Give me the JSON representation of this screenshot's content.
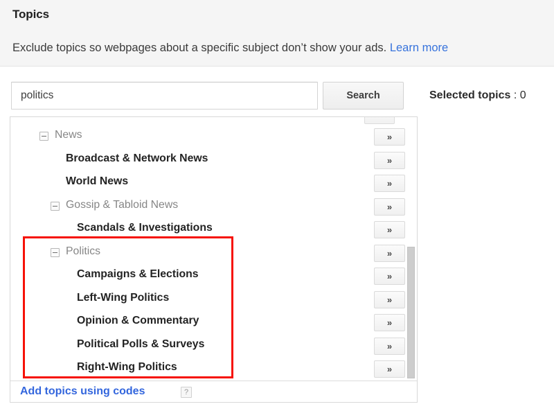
{
  "header": {
    "title": "Topics",
    "description": "Exclude topics so webpages about a specific subject don’t show your ads.",
    "learn_more_label": "Learn more",
    "link_color": "#3773dc",
    "band_background": "#f5f5f5"
  },
  "search": {
    "input_value": "politics",
    "input_placeholder": "",
    "button_label": "Search",
    "selected_topics_label": "Selected topics",
    "selected_topics_value": ": 0",
    "selected_topics_count": 0
  },
  "tree": {
    "clipped_top_row": {
      "label": "",
      "move_button_label": "»"
    },
    "move_button_label": "»",
    "toggle_icon": "minus-square-icon",
    "rows": [
      {
        "label": "News",
        "type": "parent",
        "level": 0,
        "expanded": true,
        "indent": 42,
        "label_indent": 64,
        "highlighted": false
      },
      {
        "label": "Broadcast & Network News",
        "type": "leaf",
        "level": 1,
        "expanded": false,
        "indent": 0,
        "label_indent": 80,
        "highlighted": false
      },
      {
        "label": "World News",
        "type": "leaf",
        "level": 1,
        "expanded": false,
        "indent": 0,
        "label_indent": 80,
        "highlighted": false
      },
      {
        "label": "Gossip & Tabloid News",
        "type": "parent",
        "level": 1,
        "expanded": true,
        "indent": 58,
        "label_indent": 80,
        "highlighted": false
      },
      {
        "label": "Scandals & Investigations",
        "type": "leaf",
        "level": 2,
        "expanded": false,
        "indent": 0,
        "label_indent": 96,
        "highlighted": false
      },
      {
        "label": "Politics",
        "type": "parent",
        "level": 1,
        "expanded": true,
        "indent": 58,
        "label_indent": 80,
        "highlighted": true
      },
      {
        "label": "Campaigns & Elections",
        "type": "leaf",
        "level": 2,
        "expanded": false,
        "indent": 0,
        "label_indent": 96,
        "highlighted": true
      },
      {
        "label": "Left-Wing Politics",
        "type": "leaf",
        "level": 2,
        "expanded": false,
        "indent": 0,
        "label_indent": 96,
        "highlighted": true
      },
      {
        "label": "Opinion & Commentary",
        "type": "leaf",
        "level": 2,
        "expanded": false,
        "indent": 0,
        "label_indent": 96,
        "highlighted": true
      },
      {
        "label": "Political Polls & Surveys",
        "type": "leaf",
        "level": 2,
        "expanded": false,
        "indent": 0,
        "label_indent": 96,
        "highlighted": true
      },
      {
        "label": "Right-Wing Politics",
        "type": "leaf",
        "level": 2,
        "expanded": false,
        "indent": 0,
        "label_indent": 96,
        "highlighted": true
      }
    ],
    "scrollbar": {
      "thumb_top_pct": 49,
      "thumb_height_pct": 50
    }
  },
  "footer": {
    "add_codes_label": "Add topics using codes",
    "help_icon_label": "?",
    "link_color": "#3366dd"
  },
  "annotation": {
    "color": "#f61105",
    "target_group": "Politics",
    "covers_rows": [
      "Politics",
      "Campaigns & Elections",
      "Left-Wing Politics",
      "Opinion & Commentary",
      "Political Polls & Surveys",
      "Right-Wing Politics"
    ]
  }
}
